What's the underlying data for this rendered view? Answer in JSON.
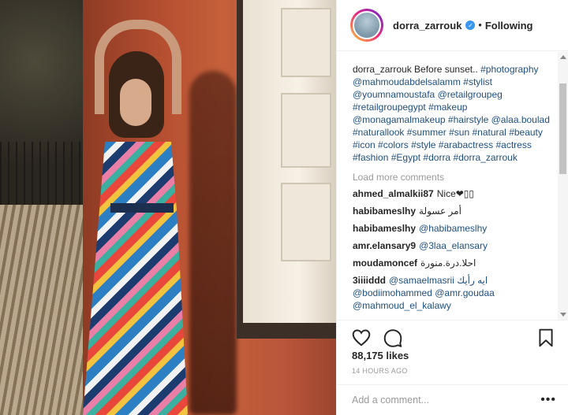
{
  "header": {
    "username": "dorra_zarrouk",
    "verified_symbol": "✓",
    "separator": "•",
    "follow_status": "Following"
  },
  "caption": {
    "username": "dorra_zarrouk",
    "text": "Before sunset..",
    "tags": [
      "#photography",
      "@mahmoudabdelsalamm",
      "#stylist",
      "@youmnamoustafa",
      "@retailgroupeg",
      "#retailgroupegypt",
      "#makeup",
      "@monagamalmakeup",
      "#hairstyle",
      "@alaa.boulad",
      "#naturallook",
      "#summer",
      "#sun",
      "#natural",
      "#beauty",
      "#icon",
      "#colors",
      "#style",
      "#arabactress",
      "#actress",
      "#fashion",
      "#Egypt",
      "#dorra",
      "#dorra_zarrouk"
    ]
  },
  "load_more": "Load more comments",
  "comments": [
    {
      "user": "ahmed_almalkii87",
      "text": "Nice❤▯▯",
      "rtl": false
    },
    {
      "user": "habibameslhy",
      "text": "أمر عسولة",
      "rtl": true
    },
    {
      "user": "habibameslhy",
      "text": "@habibameslhy",
      "rtl": false
    },
    {
      "user": "amr.elansary9",
      "text": "@3laa_elansary",
      "rtl": false
    },
    {
      "user": "moudamoncef",
      "text": "احلا.درة.منورة",
      "rtl": true
    },
    {
      "user": "3iiiiddd",
      "text": "@samaelmasrii ايه رأيك @bodiimohammed @amr.goudaa @mahmoud_el_kalawy",
      "rtl": false
    }
  ],
  "actions": {
    "like_icon": "heart-icon",
    "comment_icon": "comment-bubble-icon",
    "save_icon": "bookmark-icon"
  },
  "likes": "88,175 likes",
  "timestamp": "14 HOURS AGO",
  "add_comment": {
    "placeholder": "Add a comment...",
    "more_symbol": "•••"
  },
  "colors": {
    "link": "#1f4f82",
    "verified": "#3897f0",
    "muted": "#999999"
  }
}
